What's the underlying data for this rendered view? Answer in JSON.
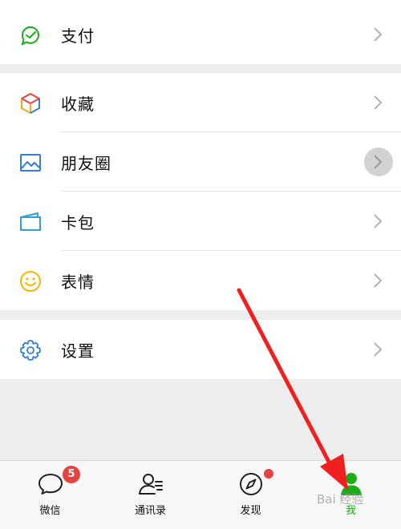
{
  "menu": {
    "pay": "支付",
    "favorites": "收藏",
    "moments": "朋友圈",
    "cards": "卡包",
    "stickers": "表情",
    "settings": "设置"
  },
  "tabbar": {
    "chats": "微信",
    "chats_badge": "5",
    "contacts": "通讯录",
    "discover": "发现",
    "me": "我"
  },
  "watermark": "Bai 经验",
  "colors": {
    "accent_green": "#1aad19",
    "badge_red": "#e64340",
    "annotation_red": "#f02020"
  }
}
